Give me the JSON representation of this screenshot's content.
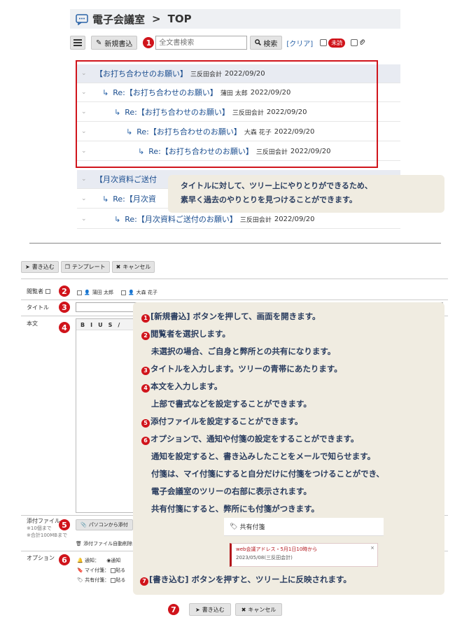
{
  "header": {
    "title": "電子会議室",
    "sep": ">",
    "page": "TOP"
  },
  "toolbar": {
    "new_post": "新規書込",
    "search_placeholder": "全文書検索",
    "search_button": "検索",
    "clear": "[クリア]",
    "unread": "未読",
    "marker1": "1"
  },
  "threads": [
    {
      "title": "【お打ち合わせのお願い】",
      "author": "三反田会計",
      "date": "2022/09/20",
      "depth": 0
    },
    {
      "title": "Re:【お打ち合わせのお願い】",
      "author": "蒲田 太郎",
      "date": "2022/09/20",
      "depth": 1
    },
    {
      "title": "Re:【お打ち合わせのお願い】",
      "author": "三反田会計",
      "date": "2022/09/20",
      "depth": 2
    },
    {
      "title": "Re:【お打ち合わせのお願い】",
      "author": "大森 花子",
      "date": "2022/09/20",
      "depth": 3
    },
    {
      "title": "Re:【お打ち合わせのお願い】",
      "author": "三反田会計",
      "date": "2022/09/20",
      "depth": 4
    },
    {
      "title": "【月次資料ご送付",
      "author": "",
      "date": "",
      "depth": 0
    },
    {
      "title": "Re:【月次資",
      "author": "",
      "date": "",
      "depth": 1
    },
    {
      "title": "Re:【月次資料ご送付のお願い】",
      "author": "三反田会計",
      "date": "2022/09/20",
      "depth": 2
    }
  ],
  "callout1": {
    "line1": "タイトルに対して、ツリー上にやりとりができるため、",
    "line2": "素早く過去のやりとりを見つけることができます。"
  },
  "form": {
    "write": "書き込む",
    "template": "テンプレート",
    "cancel": "キャンセル",
    "viewer_label": "閲覧者",
    "viewer1": "蒲田 太郎",
    "viewer2": "大森 花子",
    "title_label": "タイトル",
    "body_label": "本文",
    "attach_label": "添付ファイル",
    "attach_note1": "※10個まで",
    "attach_note2": "※合計100MBまで",
    "attach_button": "パソコンから添付",
    "attach_delete": "添付ファイル自動削除：",
    "option_label": "オプション",
    "notify": "通知：",
    "notify_val": "通知",
    "my_tag": "マイ付箋：",
    "my_tag_val": "貼る",
    "share_tag": "共有付箋：",
    "share_tag_val": "貼る",
    "editor_tools": [
      "B",
      "I",
      "U",
      "S",
      "/"
    ],
    "markers": [
      "2",
      "3",
      "4",
      "5",
      "6",
      "7"
    ]
  },
  "callout2": {
    "lines": [
      {
        "dot": "1",
        "text": "[新規書込] ボタンを押して、画面を開きます。"
      },
      {
        "dot": "2",
        "text": "閲覧者を選択します。"
      },
      {
        "dot": "",
        "text": "未選択の場合、ご自身と弊所との共有になります。"
      },
      {
        "dot": "3",
        "text": "タイトルを入力します。ツリーの青帯にあたります。"
      },
      {
        "dot": "4",
        "text": "本文を入力します。"
      },
      {
        "dot": "",
        "text": "上部で書式などを設定することができます。"
      },
      {
        "dot": "5",
        "text": "添付ファイルを設定することができます。"
      },
      {
        "dot": "6",
        "text": "オプションで、通知や付箋の設定をすることができます。"
      },
      {
        "dot": "",
        "text": "通知を設定すると、書き込みしたことをメールで知らせます。"
      },
      {
        "dot": "",
        "text": "付箋は、マイ付箋にすると自分だけに付箋をつけることができ、"
      },
      {
        "dot": "",
        "text": "電子会議室のツリーの右部に表示されます。"
      },
      {
        "dot": "",
        "text": "共有付箋にすると、弊所にも付箋がつきます。"
      }
    ],
    "last": {
      "dot": "7",
      "text": "[書き込む] ボタンを押すと、ツリー上に反映されます。"
    }
  },
  "shared_tag": {
    "header": "共有付箋",
    "line1": "web会議アドレス・5月1日10時から",
    "line2": "2023/05/08(三反田会計)",
    "close": "×"
  },
  "colors": {
    "accent_red": "#d0141b",
    "link_blue": "#1a4d8f",
    "callout_bg": "#f0ece1"
  }
}
